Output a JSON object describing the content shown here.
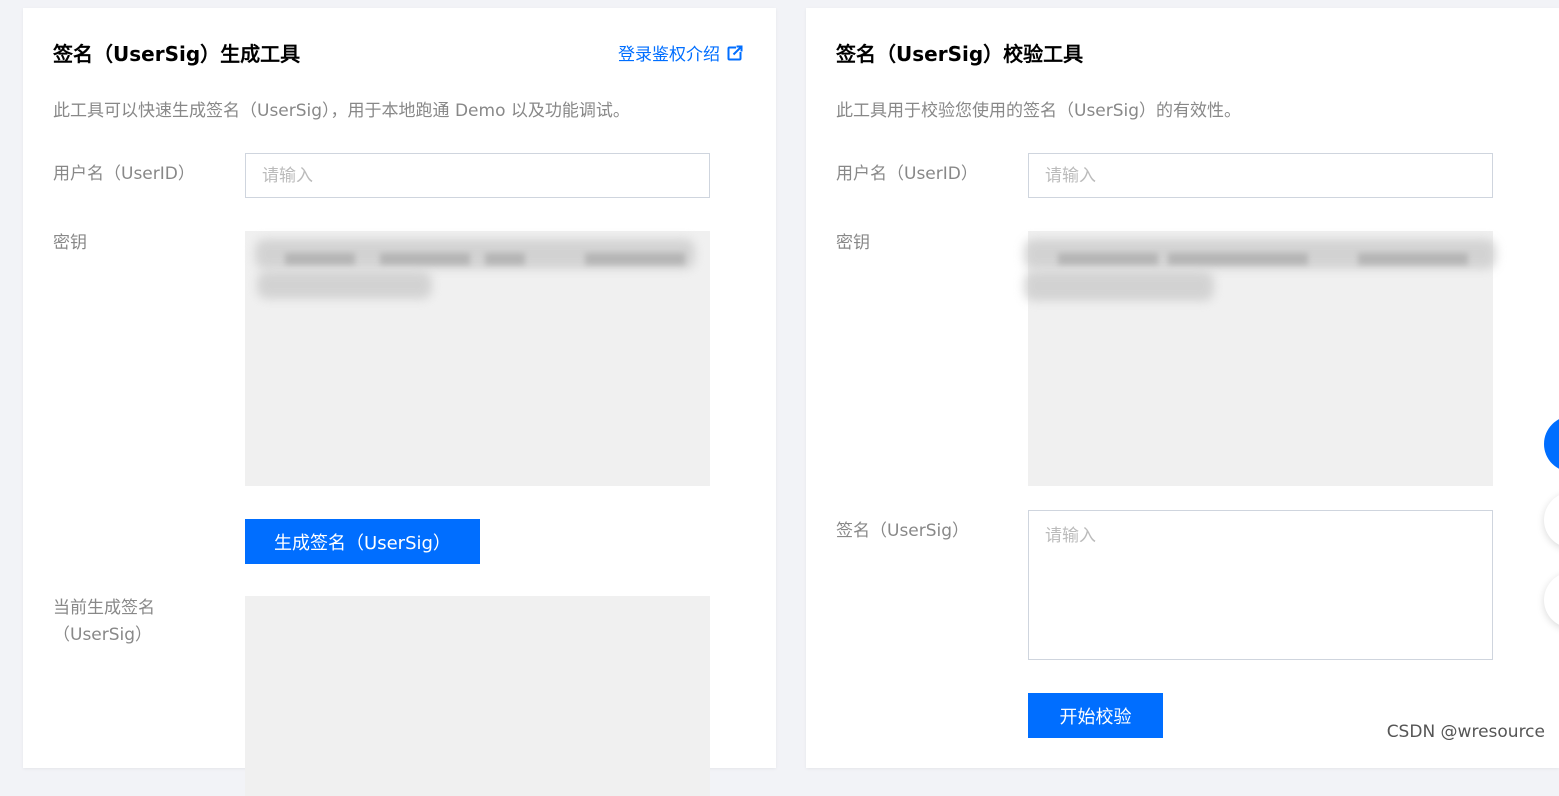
{
  "generator": {
    "title": "签名（UserSig）生成工具",
    "link": "登录鉴权介绍",
    "description": "此工具可以快速生成签名（UserSig），用于本地跑通 Demo 以及功能调试。",
    "userid_label": "用户名（UserID）",
    "userid_placeholder": "请输入",
    "key_label": "密钥",
    "generate_button": "生成签名（UserSig）",
    "current_label_line1": "当前生成签名",
    "current_label_line2": "（UserSig）"
  },
  "verifier": {
    "title": "签名（UserSig）校验工具",
    "description": "此工具用于校验您使用的签名（UserSig）的有效性。",
    "userid_label": "用户名（UserID）",
    "userid_placeholder": "请输入",
    "key_label": "密钥",
    "sig_label": "签名（UserSig）",
    "sig_placeholder": "请输入",
    "verify_button": "开始校验"
  },
  "watermark": "CSDN @wresource",
  "colors": {
    "accent": "#006eff",
    "background": "#f2f3f7",
    "muted_text": "#888888",
    "readonly_field": "#f0f0f0"
  },
  "icons": {
    "external_link": "external-link-icon"
  }
}
